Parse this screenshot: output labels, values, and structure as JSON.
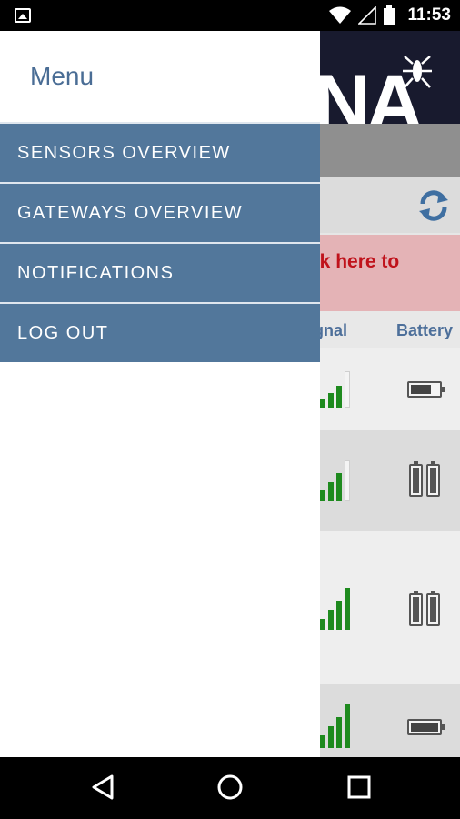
{
  "status_bar": {
    "time": "11:53"
  },
  "background_app": {
    "logo_text": "NA",
    "warning_text": "ck here to",
    "columns": {
      "signal": "ignal",
      "battery": "Battery"
    },
    "rows": [
      {
        "signal_bars": 3,
        "battery": "low"
      },
      {
        "signal_bars": 3,
        "battery": "full"
      },
      {
        "signal_bars": 5,
        "battery": "full"
      },
      {
        "signal_bars": 5,
        "battery": "full-horizontal"
      }
    ]
  },
  "drawer": {
    "title": "Menu",
    "items": [
      {
        "label": "SENSORS OVERVIEW"
      },
      {
        "label": "GATEWAYS OVERVIEW"
      },
      {
        "label": "NOTIFICATIONS"
      },
      {
        "label": "LOG OUT"
      }
    ]
  },
  "nav_bar": {
    "back": "back-icon",
    "home": "home-icon",
    "recents": "recents-icon"
  },
  "colors": {
    "menu_item_bg": "#52779b",
    "accent": "#4a6d95",
    "signal": "#1e8a1e",
    "warning": "#c0121b"
  }
}
